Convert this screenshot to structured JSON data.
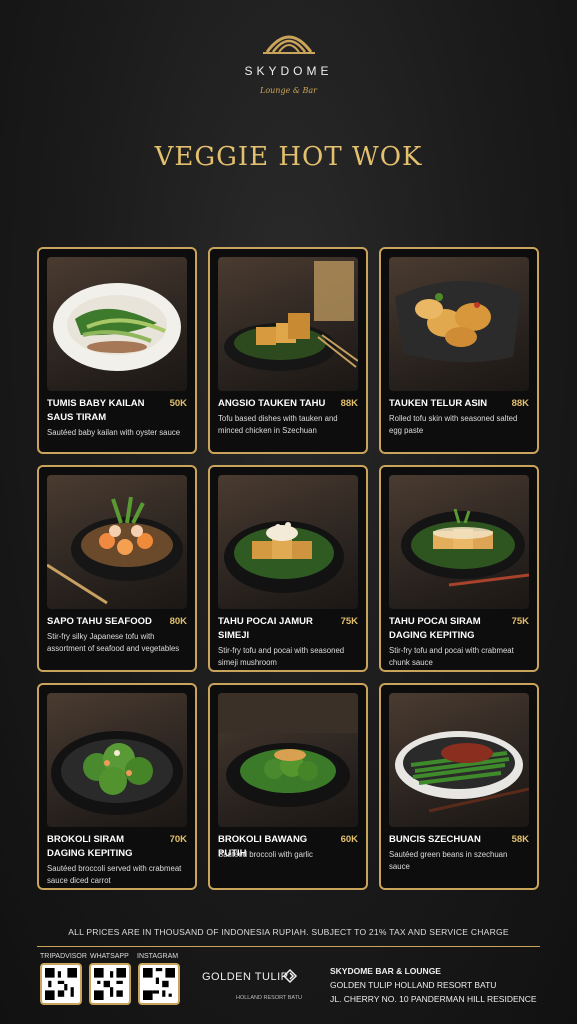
{
  "brand": {
    "name": "SKYDOME",
    "tagline": "Lounge & Bar"
  },
  "title": "VEGGIE HOT WOK",
  "items": [
    {
      "name": "TUMIS BABY KAILAN SAUS TIRAM",
      "price": "50K",
      "desc": "Sautéed baby kailan with oyster sauce"
    },
    {
      "name": "ANGSIO TAUKEN TAHU",
      "price": "88K",
      "desc": "Tofu based dishes with tauken and minced chicken in Szechuan"
    },
    {
      "name": "TAUKEN TELUR ASIN",
      "price": "88K",
      "desc": "Rolled tofu skin with seasoned salted egg paste"
    },
    {
      "name": "SAPO TAHU SEAFOOD",
      "price": "80K",
      "desc": "Stir-fry silky Japanese tofu with assortment of seafood and vegetables"
    },
    {
      "name": "TAHU POCAI JAMUR SIMEJI",
      "price": "75K",
      "desc": "Stir-fry tofu and pocai with seasoned simeji mushroom"
    },
    {
      "name": "TAHU POCAI SIRAM DAGING KEPITING",
      "price": "75K",
      "desc": "Stir-fry tofu and pocai with crabmeat chunk sauce"
    },
    {
      "name": "BROKOLI SIRAM DAGING KEPITING",
      "price": "70K",
      "desc": "Sautéed broccoli served with crabmeat sauce diced carrot"
    },
    {
      "name": "BROKOLI BAWANG PUTIH",
      "price": "60K",
      "desc": "Sautéed broccoli with garlic"
    },
    {
      "name": "BUNCIS SZECHUAN",
      "price": "58K",
      "desc": "Sautéed green beans in szechuan sauce"
    }
  ],
  "note": "ALL PRICES ARE IN THOUSAND OF INDONESIA RUPIAH. SUBJECT TO 21% TAX AND SERVICE CHARGE",
  "social": {
    "tripadvisor": "TRIPADVISOR",
    "whatsapp": "WHATSAPP",
    "instagram": "INSTAGRAM"
  },
  "hotel": {
    "name": "GOLDEN TULIP",
    "sub": "HOLLAND RESORT BATU"
  },
  "venue": {
    "name": "SKYDOME BAR & LOUNGE",
    "line1": "GOLDEN TULIP HOLLAND RESORT BATU",
    "line2": "JL. CHERRY NO. 10 PANDERMAN HILL RESIDENCE"
  },
  "colors": {
    "gold": "#caa45a",
    "gold_text": "#e3c06e",
    "background": "#1a1a1a"
  }
}
